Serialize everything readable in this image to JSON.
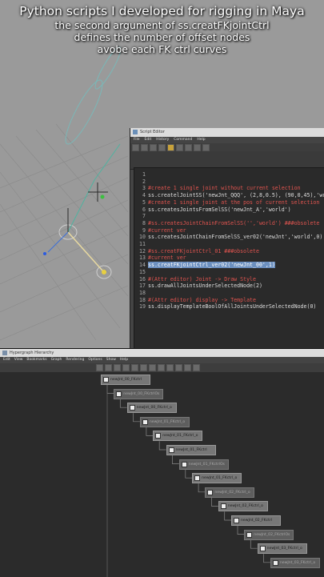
{
  "caption": {
    "line1": "Python scripts I developed for rigging in Maya",
    "line2": "the second argument of ss.creatFKjointCtrl",
    "line3": "defines the number of offset nodes",
    "line4": "avobe each FK ctrl curves"
  },
  "script_editor": {
    "title": "Script Editor",
    "menu": [
      "File",
      "Edit",
      "History",
      "Command",
      "Help"
    ],
    "tabs": [
      "Python",
      "MEL",
      "Python"
    ],
    "active_tab": "Python",
    "lines": [
      {
        "n": "1",
        "text": "",
        "style": "normal"
      },
      {
        "n": "2",
        "text": "",
        "style": "normal"
      },
      {
        "n": "3",
        "text": "#create 1 single joint without current selection",
        "style": "comment"
      },
      {
        "n": "4",
        "text": "ss.createlJointSS('newJnt_QQQ', (2,8,0.5), (90,0,45),'world'",
        "style": "normal"
      },
      {
        "n": "5",
        "text": "#create 1 single joint at the pos of current selection",
        "style": "comment"
      },
      {
        "n": "6",
        "text": "ss.createsJointsFromSelSS('newJnt_A','world')",
        "style": "normal"
      },
      {
        "n": "7",
        "text": "",
        "style": "normal"
      },
      {
        "n": "8",
        "text": "#ss.createsJointChainFromSelSS('','world') ###obsolete",
        "style": "comment"
      },
      {
        "n": "9",
        "text": "#current ver",
        "style": "comment"
      },
      {
        "n": "10",
        "text": "ss.createsJointChainFromSelSS_ver02('newJnt','world',0)",
        "style": "normal"
      },
      {
        "n": "11",
        "text": "",
        "style": "normal"
      },
      {
        "n": "12",
        "text": "#ss.creatFKjointCtrl_01 ###obsolete",
        "style": "comment"
      },
      {
        "n": "13",
        "text": "#current ver",
        "style": "comment"
      },
      {
        "n": "14",
        "text": "ss.creatFKjointCtrl_ver02('newJnt_00',1)",
        "style": "selected"
      },
      {
        "n": "15",
        "text": "",
        "style": "normal"
      },
      {
        "n": "16",
        "text": "#(Attr editor) Joint -> Draw Style",
        "style": "comment"
      },
      {
        "n": "17",
        "text": "ss.drawAllJointsUnderSelectedNode(2)",
        "style": "normal"
      },
      {
        "n": "18",
        "text": "",
        "style": "normal"
      },
      {
        "n": "18",
        "text": "#(Attr editor) display -> Template",
        "style": "comment"
      },
      {
        "n": "19",
        "text": "ss.displayTemplateBoolOfAllJointsUnderSelectedNode(0)",
        "style": "normal"
      }
    ]
  },
  "hypergraph": {
    "title": "Hypergraph Hierarchy",
    "menu": [
      "Edit",
      "View",
      "Bookmarks",
      "Graph",
      "Rendering",
      "Options",
      "Show",
      "Help"
    ],
    "nodes": [
      {
        "label": "newJnt_00_FKctrl",
        "dim": false
      },
      {
        "label": "newJnt_00_FKctrlOs",
        "dim": true
      },
      {
        "label": "newJnt_00_FKctrl_o",
        "dim": false
      },
      {
        "label": "newJnt_01_FKctrl_o",
        "dim": true
      },
      {
        "label": "newJnt_01_FKctrl_o",
        "dim": false
      },
      {
        "label": "newJnt_01_FKctrl",
        "dim": false
      },
      {
        "label": "newJnt_01_FKctrlOs",
        "dim": true
      },
      {
        "label": "newJnt_01_FKctrl_o",
        "dim": false
      },
      {
        "label": "newJnt_02_FKctrl_o",
        "dim": true
      },
      {
        "label": "newJnt_02_FKctrl_o",
        "dim": false
      },
      {
        "label": "newJnt_02_FKctrl",
        "dim": false
      },
      {
        "label": "newJnt_02_FKctrlOs",
        "dim": true
      },
      {
        "label": "newJnt_03_FKctrl_o",
        "dim": false
      },
      {
        "label": "newJnt_03_FKctrl_o",
        "dim": true
      }
    ]
  }
}
